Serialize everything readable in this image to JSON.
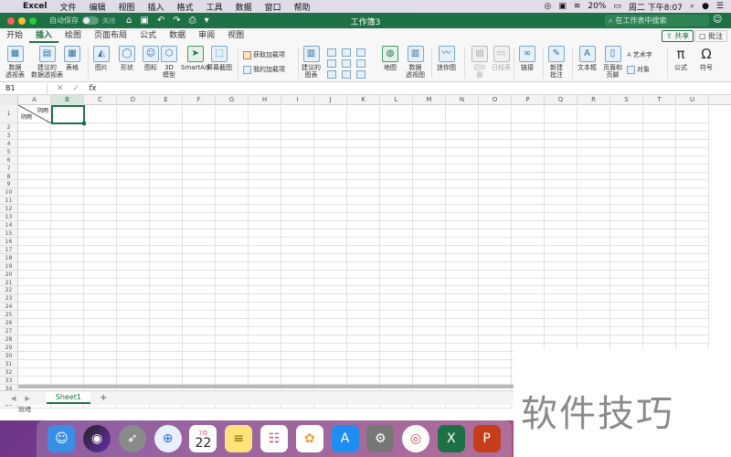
{
  "menubar": {
    "app": "Excel",
    "items": [
      "文件",
      "编辑",
      "视图",
      "插入",
      "格式",
      "工具",
      "数据",
      "窗口",
      "帮助"
    ],
    "battery": "20%",
    "clock": "周二 下午8:07"
  },
  "titlebar": {
    "autosave": "自动保存",
    "autosave_state": "关闭",
    "doc_title": "工作簿3",
    "search_placeholder": "在工作表中搜索"
  },
  "ribbon_tabs": [
    "开始",
    "插入",
    "绘图",
    "页面布局",
    "公式",
    "数据",
    "审阅",
    "视图"
  ],
  "active_tab": "插入",
  "share_label": "共享",
  "comment_label": "批注",
  "ribbon": {
    "pivot_table": "数据\n透视表",
    "recommended_pivot": "建议的\n数据透视表",
    "table": "表格",
    "pictures": "图片",
    "shapes": "形状",
    "icons": "图标",
    "model3d": "3D\n模型",
    "smartart": "SmartArt",
    "screenshot": "屏幕截图",
    "get_addins": "获取加载项",
    "my_addins": "我的加载项",
    "recommended_charts": "建议的\n图表",
    "maps": "地图",
    "pivot_chart": "数据\n透视图",
    "sparkline": "迷你图",
    "slicer": "切片\n器",
    "timeline": "日程表",
    "link": "链接",
    "new_comment": "新建\n批注",
    "textbox": "文本框",
    "header_footer": "页眉和\n页脚",
    "wordart": "艺术字",
    "object": "对象",
    "equation": "公式",
    "symbol": "符号"
  },
  "formula_bar": {
    "name_box": "B1",
    "fx": "fx",
    "content": ""
  },
  "columns": [
    "A",
    "B",
    "C",
    "D",
    "E",
    "F",
    "G",
    "H",
    "I",
    "J",
    "K",
    "L",
    "M",
    "N",
    "O",
    "P",
    "Q",
    "R",
    "S",
    "T",
    "U"
  ],
  "selected_column": "B",
  "rows": [
    "1",
    "2",
    "3",
    "4",
    "5",
    "6",
    "7",
    "8",
    "9",
    "10",
    "11",
    "12",
    "13",
    "14",
    "15",
    "16",
    "17",
    "18",
    "19",
    "20",
    "21",
    "22",
    "23",
    "24",
    "25",
    "26",
    "27",
    "28",
    "29",
    "30",
    "31",
    "32",
    "33",
    "34",
    "35",
    "36"
  ],
  "cell_A1": {
    "top_right": "阴雨",
    "bottom_left": "阴雨"
  },
  "sheet_tabs": [
    "Sheet1"
  ],
  "status": "就绪",
  "calendar_day": "22",
  "calendar_month": "7月",
  "watermark": "软件技巧",
  "colors": {
    "excel_green": "#1e7145"
  }
}
